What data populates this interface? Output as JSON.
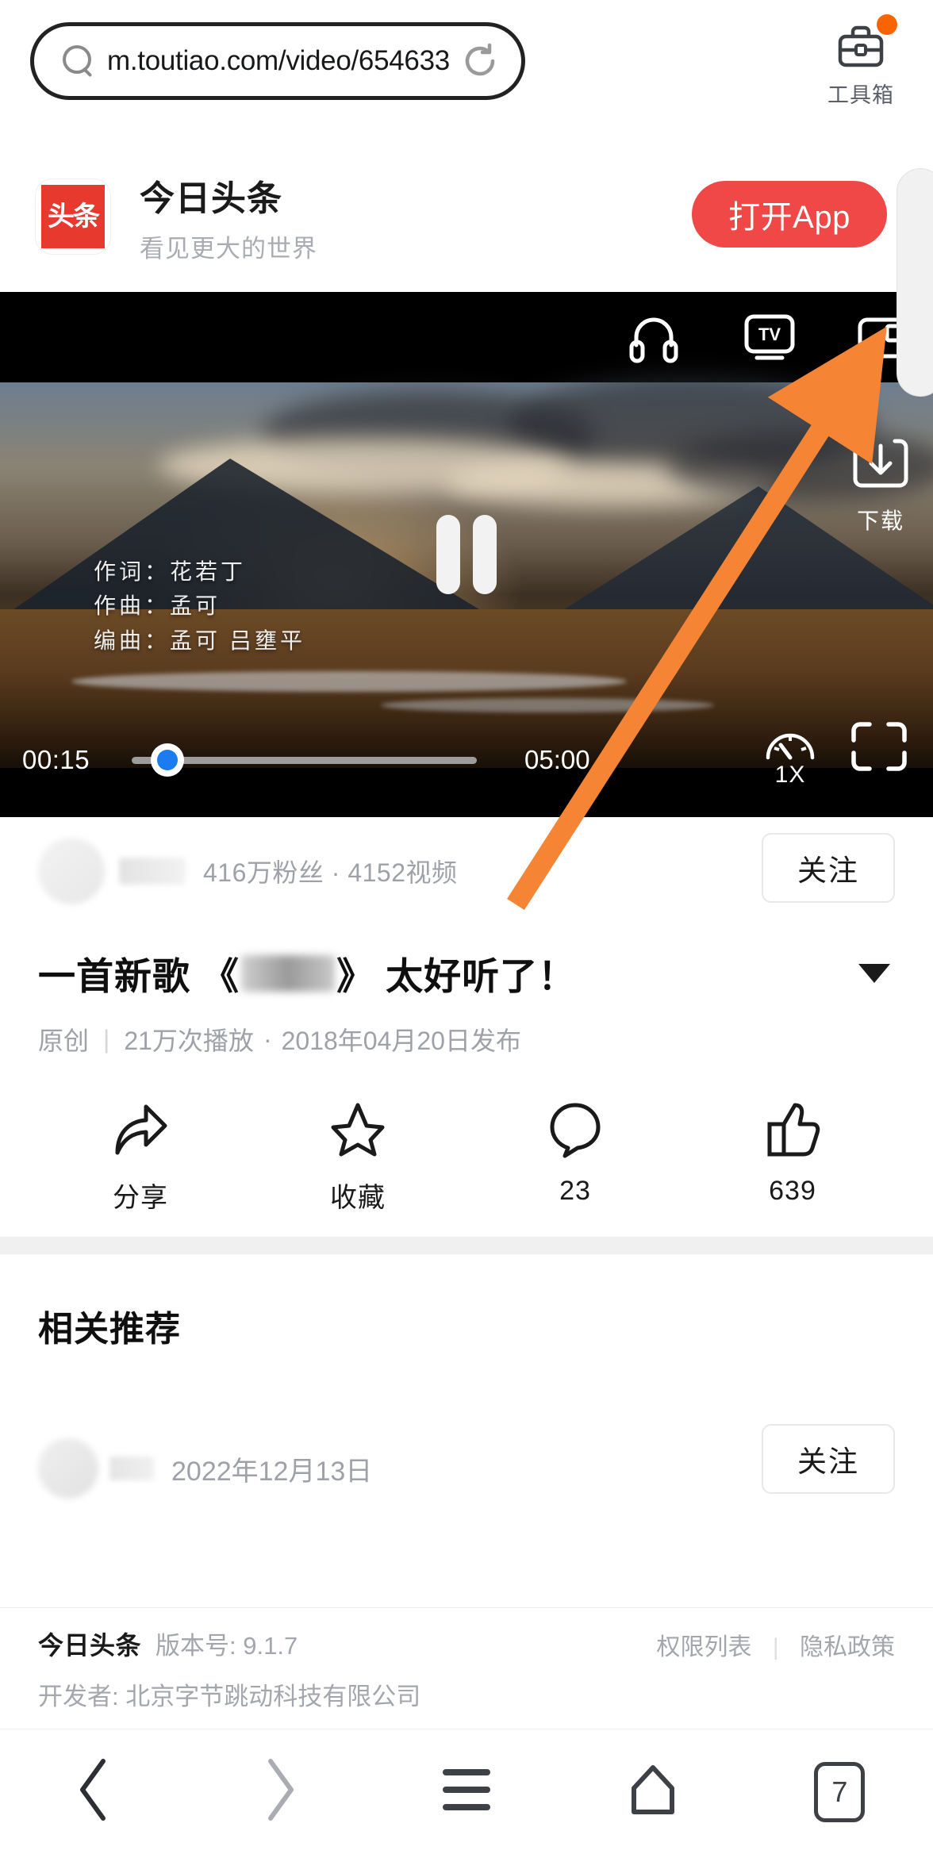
{
  "browser": {
    "url": "m.toutiao.com/video/654633…",
    "search_icon": "search-icon",
    "reload_icon": "reload-icon",
    "toolbox_label": "工具箱",
    "toolbox_icon": "toolbox-icon",
    "badge_color": "#fa6400",
    "nav": {
      "back": "back-icon",
      "forward": "forward-icon",
      "menu": "menu-icon",
      "home": "home-icon",
      "tab_count": "7"
    }
  },
  "app_banner": {
    "logo_text": "头条",
    "title": "今日头条",
    "subtitle": "看见更大的世界",
    "open_button": "打开App",
    "button_color": "#f04846"
  },
  "player": {
    "top_icons": [
      "headphones-icon",
      "tv-cast-icon",
      "picture-in-picture-icon"
    ],
    "pause_icon": "pause-icon",
    "download_icon": "download-icon",
    "download_label": "下载",
    "current_time": "00:15",
    "total_time": "05:00",
    "progress_percent": 5,
    "speed_label": "1X",
    "speed_icon": "speed-gauge-icon",
    "fullscreen_icon": "fullscreen-icon",
    "credits": [
      "作词：花若丁",
      "作曲：孟可",
      "编曲：孟可  吕壅平"
    ],
    "accent_color": "#1a7cf0"
  },
  "annotation": {
    "arrow_color": "#f58535",
    "points_to": "download-button"
  },
  "article": {
    "author_stats": "416万粉丝 · 4152视频",
    "follow_label": "关注",
    "title_prefix": "一首新歌 《",
    "title_suffix": "》 太好听了！",
    "expand_icon": "chevron-down-icon",
    "meta_original": "原创",
    "meta_plays": "21万次播放",
    "meta_dot": "·",
    "meta_date": "2018年04月20日发布",
    "actions": [
      {
        "icon": "share-icon",
        "label": "分享"
      },
      {
        "icon": "star-icon",
        "label": "收藏"
      },
      {
        "icon": "comment-icon",
        "label": "23"
      },
      {
        "icon": "thumbs-up-icon",
        "label": "639"
      }
    ]
  },
  "recommend": {
    "heading": "相关推荐",
    "items": [
      {
        "date": "2022年12月13日",
        "follow_label": "关注"
      }
    ]
  },
  "app_footer": {
    "brand": "今日头条",
    "version": "版本号: 9.1.7",
    "developer": "开发者: 北京字节跳动科技有限公司",
    "link_permissions": "权限列表",
    "link_separator": "|",
    "link_privacy": "隐私政策"
  }
}
